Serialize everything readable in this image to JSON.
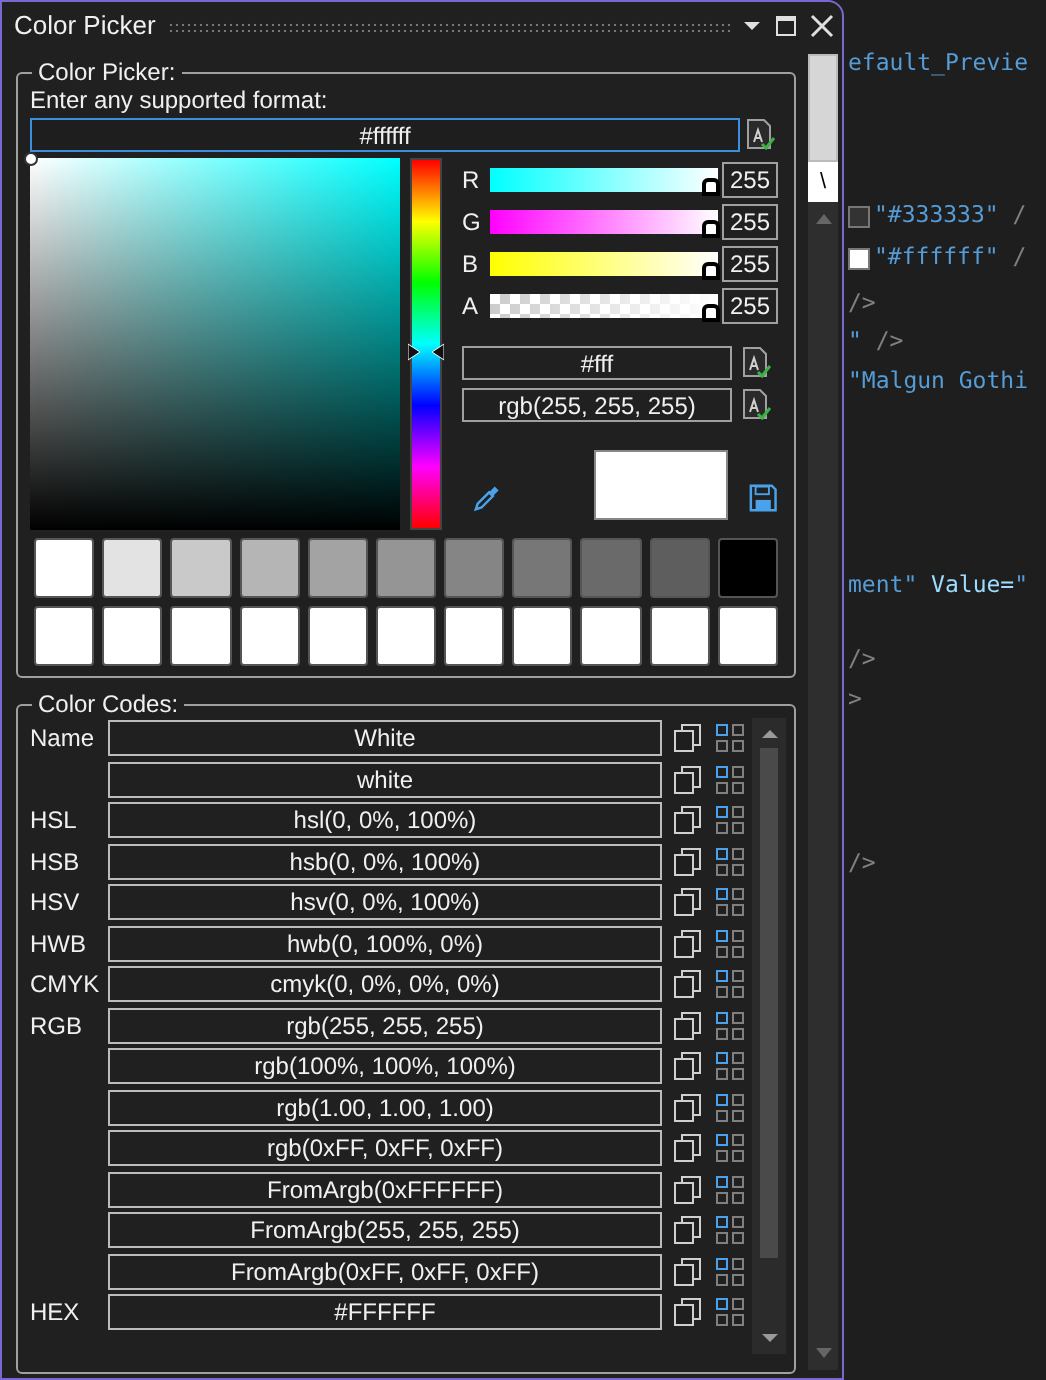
{
  "panel": {
    "title": "Color Picker",
    "side_tab": "\\"
  },
  "picker": {
    "group_title": "Color Picker:",
    "prompt": "Enter any supported format:",
    "input_value": "#ffffff",
    "hue": {
      "level": 0.48
    },
    "channels": [
      {
        "label": "R",
        "kind": "red",
        "level": 1,
        "value": "255"
      },
      {
        "label": "G",
        "kind": "green",
        "level": 1,
        "value": "255"
      },
      {
        "label": "B",
        "kind": "blue",
        "level": 1,
        "value": "255"
      },
      {
        "label": "A",
        "kind": "alpha",
        "level": 1,
        "value": "255"
      }
    ],
    "short_value": "#fff",
    "rgb_value": "rgb(255, 255, 255)",
    "preview": {
      "color": "#ffffff"
    },
    "swatch_rows": [
      [
        {
          "color": "#ffffff"
        },
        {
          "color": "#e3e3e3"
        },
        {
          "color": "#c9c9c9"
        },
        {
          "color": "#b5b5b5"
        },
        {
          "color": "#a3a3a3"
        },
        {
          "color": "#959595"
        },
        {
          "color": "#858585"
        },
        {
          "color": "#777777"
        },
        {
          "color": "#6a6a6a"
        },
        {
          "color": "#5e5e5e"
        },
        {
          "color": "#000000"
        }
      ],
      [
        {
          "color": "#ffffff"
        },
        {
          "color": "#ffffff"
        },
        {
          "color": "#ffffff"
        },
        {
          "color": "#ffffff"
        },
        {
          "color": "#ffffff"
        },
        {
          "color": "#ffffff"
        },
        {
          "color": "#ffffff"
        },
        {
          "color": "#ffffff"
        },
        {
          "color": "#ffffff"
        },
        {
          "color": "#ffffff"
        },
        {
          "color": "#ffffff"
        }
      ]
    ]
  },
  "codes": {
    "group_title": "Color Codes:",
    "rows": [
      {
        "label": "Name",
        "value": "White"
      },
      {
        "value": "white"
      },
      {
        "label": "HSL",
        "value": "hsl(0, 0%, 100%)"
      },
      {
        "label": "HSB",
        "value": "hsb(0, 0%, 100%)"
      },
      {
        "label": "HSV",
        "value": "hsv(0, 0%, 100%)"
      },
      {
        "label": "HWB",
        "value": "hwb(0, 100%, 0%)"
      },
      {
        "label": "CMYK",
        "value": "cmyk(0, 0%, 0%, 0%)"
      },
      {
        "label": "RGB",
        "value": "rgb(255, 255, 255)"
      },
      {
        "value": "rgb(100%, 100%, 100%)"
      },
      {
        "value": "rgb(1.00, 1.00, 1.00)"
      },
      {
        "value": "rgb(0xFF, 0xFF, 0xFF)"
      },
      {
        "value": "FromArgb(0xFFFFFF)"
      },
      {
        "value": "FromArgb(255, 255, 255)"
      },
      {
        "value": "FromArgb(0xFF, 0xFF, 0xFF)"
      },
      {
        "label": "HEX",
        "value": "#FFFFFF"
      }
    ]
  },
  "editor": {
    "lines": [
      {
        "segments": [
          {
            "kind": "string",
            "text": "efault_Previe"
          }
        ]
      },
      {
        "chip": {
          "color": "#333333"
        },
        "segments": [
          {
            "kind": "string",
            "text": "\"#333333\""
          },
          {
            "kind": "punct",
            "text": " /"
          }
        ]
      },
      {
        "chip": {
          "color": "#ffffff"
        },
        "segments": [
          {
            "kind": "string",
            "text": "\"#ffffff\""
          },
          {
            "kind": "punct",
            "text": " /"
          }
        ]
      },
      {
        "segments": [
          {
            "kind": "punct",
            "text": "/>"
          }
        ]
      },
      {
        "segments": [
          {
            "kind": "string",
            "text": "\""
          },
          {
            "kind": "punct",
            "text": " />"
          }
        ]
      },
      {
        "segments": [
          {
            "kind": "string",
            "text": "\"Malgun Gothi"
          }
        ]
      },
      {
        "segments": [
          {
            "kind": "string",
            "text": "ment\""
          },
          {
            "kind": "attr",
            "text": " Value="
          },
          {
            "kind": "string",
            "text": "\""
          }
        ]
      },
      {
        "segments": [
          {
            "kind": "punct",
            "text": "/>"
          }
        ]
      },
      {
        "segments": [
          {
            "kind": "punct",
            "text": ">"
          }
        ]
      },
      {
        "segments": [
          {
            "kind": "punct",
            "text": "/>"
          }
        ]
      }
    ]
  }
}
